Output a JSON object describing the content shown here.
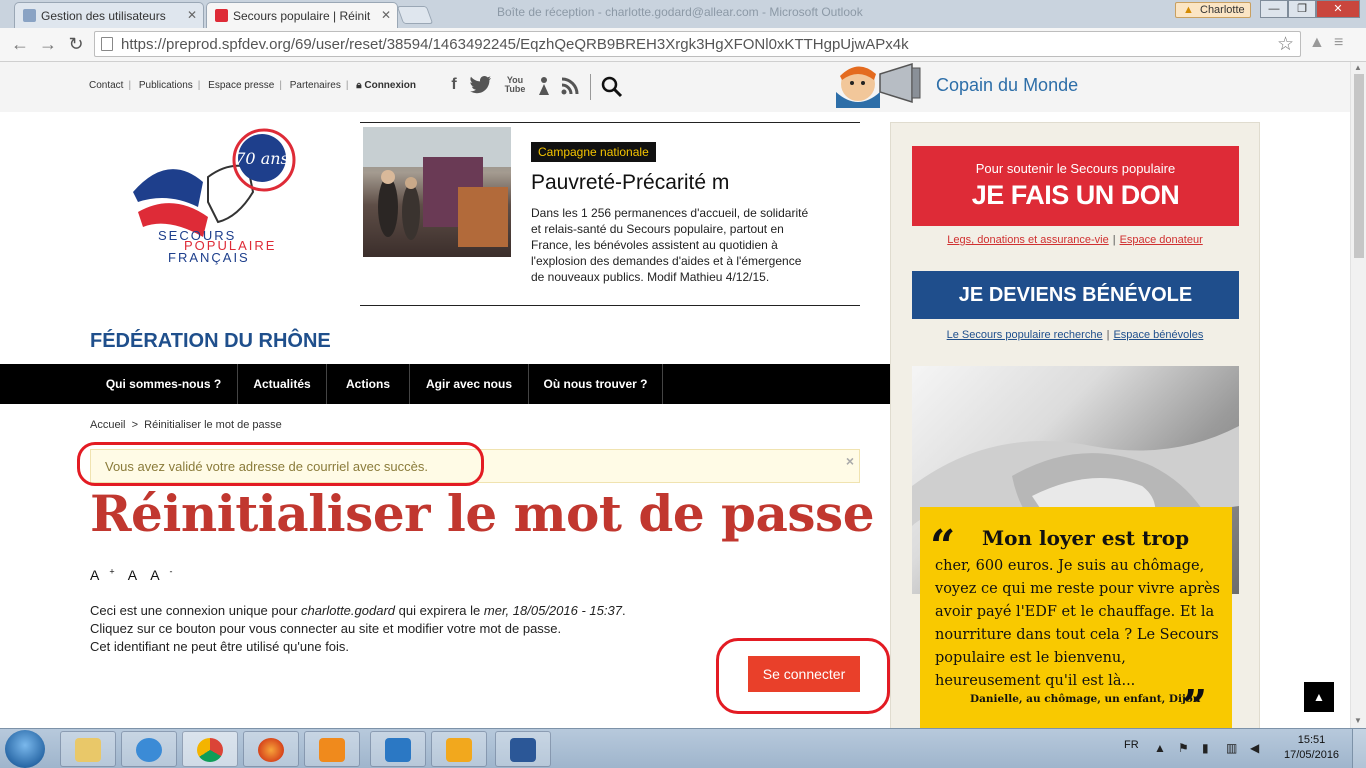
{
  "browser": {
    "tabs": [
      {
        "label": "Gestion des utilisateurs",
        "active": false
      },
      {
        "label": "Secours populaire | Réinit",
        "active": true
      }
    ],
    "bg_window_title": "Boîte de réception - charlotte.godard@allear.com - Microsoft Outlook",
    "user_name": "Charlotte",
    "url": "https://preprod.spfdev.org/69/user/reset/38594/1463492245/EqzhQeQRB9BREH3Xrgk3HgXFONl0xKTTHgpUjwAPx4k",
    "window_buttons": {
      "minimize": "—",
      "restore": "❐",
      "close": "✕"
    }
  },
  "site": {
    "top_links": [
      "Contact",
      "Publications",
      "Espace presse",
      "Partenaires"
    ],
    "login_label": "Connexion",
    "social_icons": [
      "facebook-icon",
      "twitter-icon",
      "youtube-icon",
      "instagram-icon",
      "rss-icon"
    ],
    "youtube_text": "You Tube",
    "copain_label": "Copain du Monde",
    "logo": {
      "badge": "70 ans",
      "line1": "SECOURS",
      "line2": "POPULAIRE",
      "line3": "FRANÇAIS"
    },
    "featured": {
      "tag": "Campagne nationale",
      "title": "Pauvreté-Précarité m",
      "text": "Dans les 1 256 permanences d'accueil, de solidarité et relais-santé du Secours populaire, partout en France, les bénévoles assistent au quotidien à l'explosion des demandes d'aides et à l'émergence de nouveaux publics. Modif Mathieu 4/12/15."
    },
    "federation": "FÉDÉRATION DU RHÔNE",
    "nav": [
      "Qui sommes-nous ?",
      "Actualités",
      "Actions",
      "Agir avec nous",
      "Où nous trouver ?"
    ],
    "breadcrumb": {
      "home": "Accueil",
      "separator": ">",
      "current": "Réinitialiser le mot de passe"
    },
    "alert": {
      "message": "Vous avez validé votre adresse de courriel avec succès.",
      "close": "×"
    },
    "page_title": "Réinitialiser le mot de passe",
    "font_controls": {
      "larger": "A",
      "larger_sup": "+",
      "normal": "A",
      "smaller": "A",
      "smaller_sup": "-"
    },
    "info": {
      "line1_a": "Ceci est une connexion unique pour ",
      "user": "charlotte.godard",
      "line1_b": " qui expirera le ",
      "expiry": "mer, 18/05/2016 - 15:37",
      "line1_c": ".",
      "line2": "Cliquez sur ce bouton pour vous connecter au site et modifier votre mot de passe.",
      "line3": "Cet identifiant ne peut être utilisé qu'une fois."
    },
    "connect_button": "Se connecter",
    "sidebar": {
      "don_small": "Pour soutenir le Secours populaire",
      "don_big": "JE FAIS UN DON",
      "don_links": [
        "Legs, donations et assurance-vie",
        "Espace donateur"
      ],
      "benevole": "JE DEVIENS BÉNÉVOLE",
      "benevole_links": [
        "Le Secours populaire recherche",
        "Espace bénévoles"
      ],
      "quote_open": "“",
      "quote_title": "Mon loyer est trop",
      "quote_body": "cher, 600 euros. Je suis au chômage, voyez ce qui me reste pour vivre après avoir payé l'EDF et le chauffage. Et la nourriture dans tout cela ? Le Secours populaire est le bienvenu, heureusement qu'il est là...",
      "quote_signature": "Danielle, au chômage, un enfant, Dijon",
      "quote_close": "”"
    },
    "scroll_top": "▲"
  },
  "taskbar": {
    "apps": [
      "explorer",
      "internet-explorer",
      "chrome",
      "firefox",
      "media-player",
      "lync",
      "outlook",
      "word"
    ],
    "language": "FR",
    "time": "15:51",
    "date": "17/05/2016"
  },
  "colors": {
    "title_red": "#c1372f",
    "don_red": "#de2b37",
    "benevole_blue": "#1f4e8c",
    "connect_orange": "#e9402a",
    "quote_yellow": "#f9c900",
    "annotation_red": "#e31b23"
  }
}
